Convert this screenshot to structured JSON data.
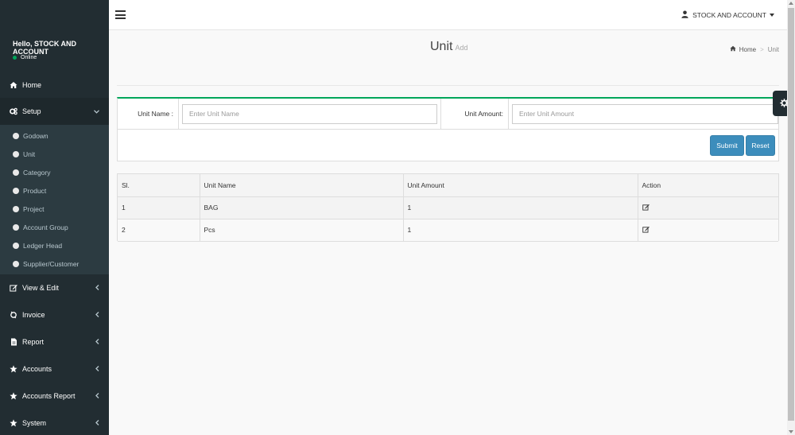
{
  "sidebar": {
    "greeting": "Hello, STOCK AND ACCOUNT",
    "status": "Online",
    "home": "Home",
    "setup": {
      "label": "Setup",
      "items": [
        "Godown",
        "Unit",
        "Category",
        "Product",
        "Project",
        "Account Group",
        "Ledger Head",
        "Supplier/Customer"
      ]
    },
    "menus": [
      "View & Edit",
      "Invoice",
      "Report",
      "Accounts",
      "Accounts Report",
      "System"
    ]
  },
  "header": {
    "user": "STOCK AND ACCOUNT"
  },
  "page": {
    "title": "Unit",
    "subtitle": "Add"
  },
  "breadcrumb": {
    "home": "Home",
    "current": "Unit"
  },
  "form": {
    "unit_name_label": "Unit Name :",
    "unit_name_placeholder": "Enter Unit Name",
    "unit_amount_label": "Unit Amount:",
    "unit_amount_placeholder": "Enter Unit Amount",
    "submit": "Submit",
    "reset": "Reset"
  },
  "table": {
    "headers": [
      "Sl.",
      "Unit Name",
      "Unit Amount",
      "Action"
    ],
    "rows": [
      [
        "1",
        "BAG",
        "1"
      ],
      [
        "2",
        "Pcs",
        "1"
      ]
    ]
  },
  "colors": {
    "sidebar_bg": "#222d32",
    "accent_green": "#00a65a",
    "button_blue": "#3c8dbc"
  }
}
